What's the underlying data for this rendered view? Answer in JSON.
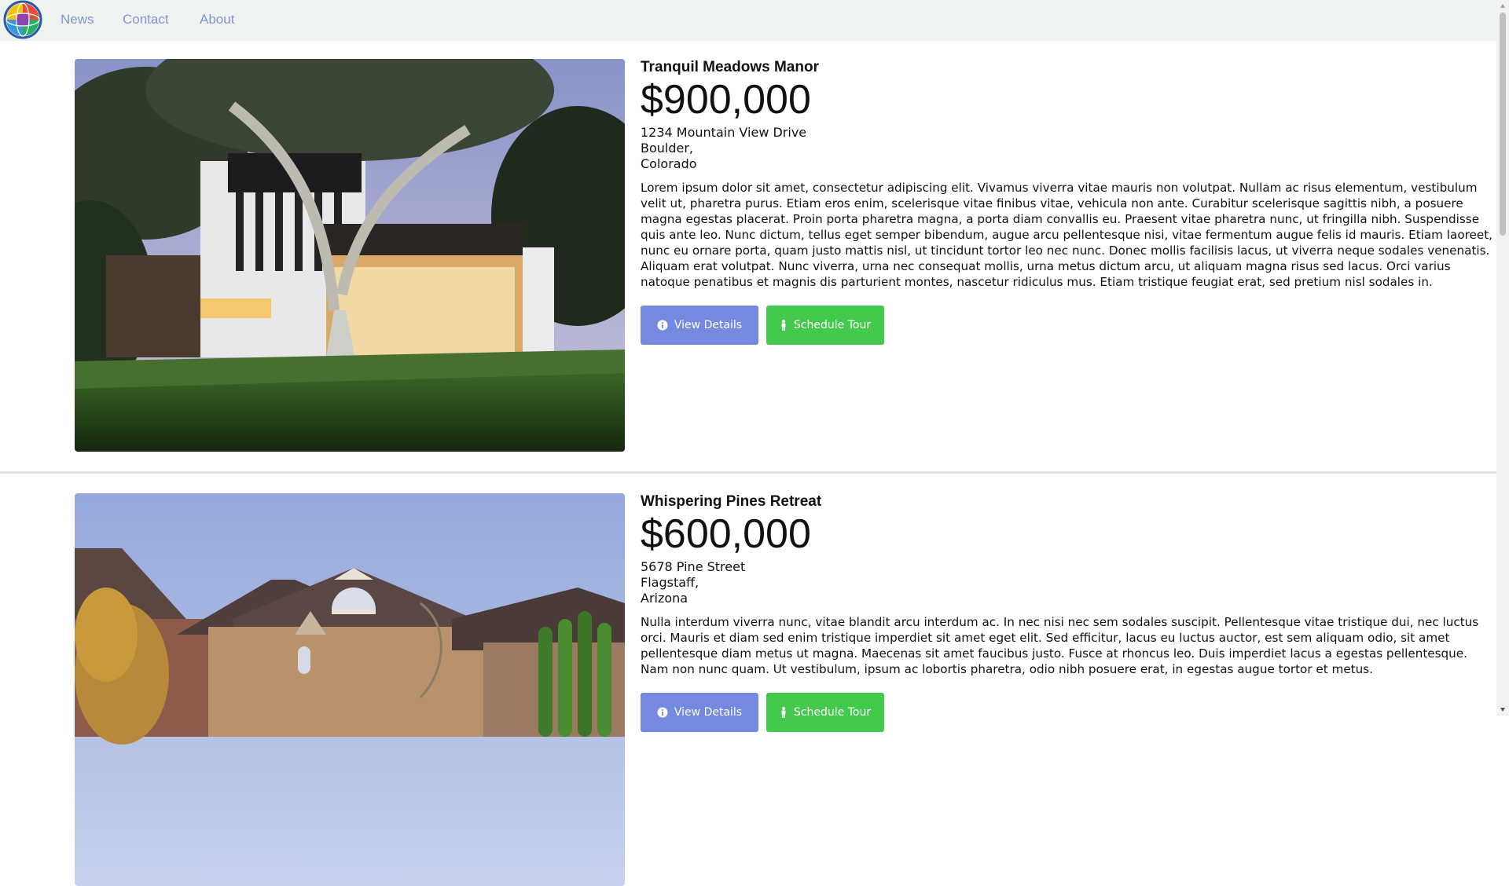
{
  "nav": {
    "links": [
      "News",
      "Contact",
      "About"
    ]
  },
  "listings": [
    {
      "name": "Tranquil Meadows Manor",
      "price": "$900,000",
      "street": "1234 Mountain View Drive",
      "city": "Boulder,",
      "state": "Colorado",
      "description": "Lorem ipsum dolor sit amet, consectetur adipiscing elit. Vivamus viverra vitae mauris non volutpat. Nullam ac risus elementum, vestibulum velit ut, pharetra purus. Etiam eros enim, scelerisque vitae finibus vitae, vehicula non ante. Curabitur scelerisque sagittis nibh, a posuere magna egestas placerat. Proin porta pharetra magna, a porta diam convallis eu. Praesent vitae pharetra nunc, ut fringilla nibh. Suspendisse quis ante leo. Nunc dictum, tellus eget semper bibendum, augue arcu pellentesque nisi, vitae fermentum augue felis id mauris. Etiam laoreet, nunc eu ornare porta, quam justo mattis nisl, ut tincidunt tortor leo nec nunc. Donec mollis facilisis lacus, ut viverra neque sodales venenatis. Aliquam erat volutpat. Nunc viverra, urna nec consequat mollis, urna metus dictum arcu, ut aliquam magna risus sed lacus. Orci varius natoque penatibus et magnis dis parturient montes, nascetur ridiculus mus. Etiam tristique feugiat erat, sed pretium nisl sodales in.",
      "details_label": "View Details",
      "tour_label": "Schedule Tour"
    },
    {
      "name": "Whispering Pines Retreat",
      "price": "$600,000",
      "street": "5678 Pine Street",
      "city": "Flagstaff,",
      "state": "Arizona",
      "description": "Nulla interdum viverra nunc, vitae blandit arcu interdum ac. In nec nisi nec sem sodales suscipit. Pellentesque vitae tristique dui, nec luctus orci. Mauris et diam sed enim tristique imperdiet sit amet eget elit. Sed efficitur, lacus eu luctus auctor, est sem aliquam odio, sit amet pellentesque diam metus ut magna. Maecenas sit amet faucibus justo. Fusce at rhoncus leo. Duis imperdiet lacus a egestas pellentesque. Nam non nunc quam. Ut vestibulum, ipsum ac lobortis pharetra, odio nibh posuere erat, in egestas augue tortor et metus.",
      "details_label": "View Details",
      "tour_label": "Schedule Tour"
    }
  ],
  "colors": {
    "nav_bg": "#eff3f0",
    "nav_link": "#8793d6",
    "details_button": "#7589e0",
    "tour_button": "#43c94b"
  },
  "icons": {
    "logo": "globe-logo-icon",
    "details": "info-circle-icon",
    "tour": "person-icon"
  }
}
